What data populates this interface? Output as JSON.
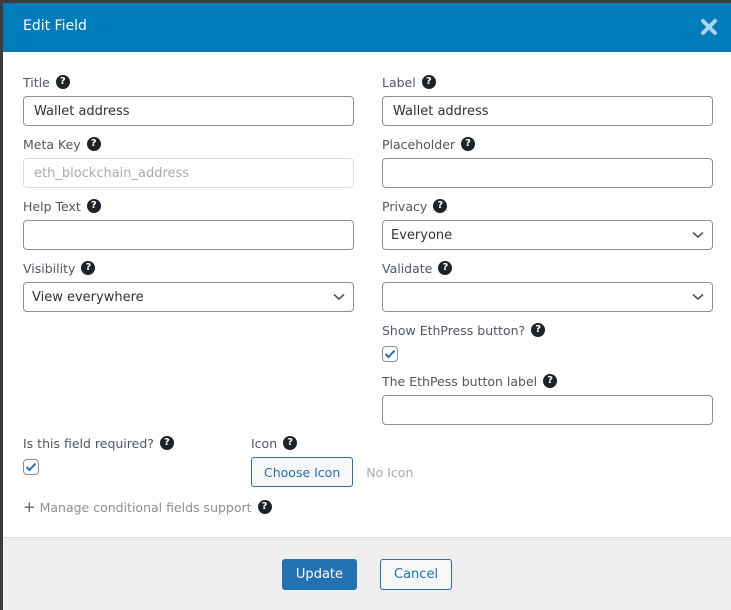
{
  "modal": {
    "title": "Edit Field",
    "close_icon": "close-icon"
  },
  "fields": {
    "title": {
      "label": "Title",
      "value": "Wallet address"
    },
    "label": {
      "label": "Label",
      "value": "Wallet address"
    },
    "meta_key": {
      "label": "Meta Key",
      "value": "eth_blockchain_address",
      "disabled": true
    },
    "placeholder": {
      "label": "Placeholder",
      "value": ""
    },
    "help_text": {
      "label": "Help Text",
      "value": ""
    },
    "privacy": {
      "label": "Privacy",
      "selected": "Everyone"
    },
    "visibility": {
      "label": "Visibility",
      "selected": "View everywhere"
    },
    "validate": {
      "label": "Validate",
      "selected": ""
    },
    "show_ethpress": {
      "label": "Show EthPress button?",
      "checked": true
    },
    "ethpress_label": {
      "label": "The EthPess button label",
      "value": ""
    },
    "required": {
      "label": "Is this field required?",
      "checked": true
    },
    "icon": {
      "label": "Icon",
      "button": "Choose Icon",
      "status": "No Icon"
    }
  },
  "manage_conditional": {
    "prefix": "+",
    "label": "Manage conditional fields support"
  },
  "help_icon": "?",
  "footer": {
    "update_label": "Update",
    "cancel_label": "Cancel"
  },
  "colors": {
    "header_bg": "#007cba",
    "primary": "#2271b1",
    "footer_bg": "#efefef"
  }
}
